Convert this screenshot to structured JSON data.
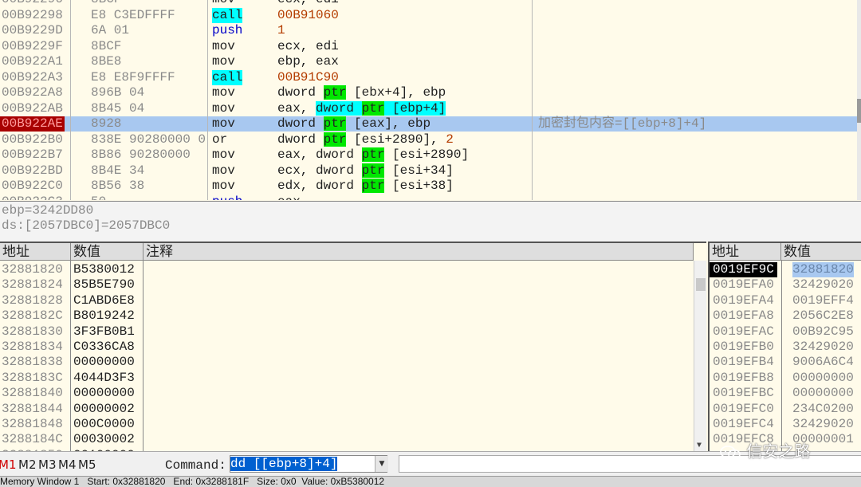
{
  "disasm": {
    "rows": [
      {
        "addr": "00B92296",
        "hex": "8BCF",
        "mn": "mov",
        "mn_style": "plain",
        "op": [
          {
            "t": "ecx, edi"
          }
        ],
        "partial": "top"
      },
      {
        "addr": "00B92298",
        "hex": "E8 C3EDFFFF",
        "mn": "call",
        "mn_style": "call",
        "op": [
          {
            "t": "00B91060",
            "s": "tgt"
          }
        ]
      },
      {
        "addr": "00B9229D",
        "hex": "6A 01",
        "mn": "push",
        "mn_style": "push",
        "op": [
          {
            "t": "1",
            "s": "num"
          }
        ]
      },
      {
        "addr": "00B9229F",
        "hex": "8BCF",
        "mn": "mov",
        "mn_style": "plain",
        "op": [
          {
            "t": "ecx, edi"
          }
        ]
      },
      {
        "addr": "00B922A1",
        "hex": "8BE8",
        "mn": "mov",
        "mn_style": "plain",
        "op": [
          {
            "t": "ebp, eax"
          }
        ]
      },
      {
        "addr": "00B922A3",
        "hex": "E8 E8F9FFFF",
        "mn": "call",
        "mn_style": "call",
        "op": [
          {
            "t": "00B91C90",
            "s": "tgt"
          }
        ]
      },
      {
        "addr": "00B922A8",
        "hex": "896B 04",
        "mn": "mov",
        "mn_style": "plain",
        "op": [
          {
            "t": "dword "
          },
          {
            "t": "ptr",
            "s": "ptr"
          },
          {
            "t": " [ebx+4], ebp"
          }
        ]
      },
      {
        "addr": "00B922AB",
        "hex": "8B45 04",
        "mn": "mov",
        "mn_style": "plain",
        "op": [
          {
            "t": "eax, "
          },
          {
            "t": "dword ",
            "s": "selbox"
          },
          {
            "t": "ptr",
            "s": "ptr"
          },
          {
            "t": " [ebp+4]",
            "s": "selbox"
          }
        ]
      },
      {
        "addr": "00B922AE",
        "hex": "8928",
        "mn": "mov",
        "mn_style": "plain",
        "op": [
          {
            "t": "dword "
          },
          {
            "t": "ptr",
            "s": "ptr"
          },
          {
            "t": " [eax], ebp"
          }
        ],
        "comment": "加密封包内容=[[ebp+8]+4]",
        "selected": true
      },
      {
        "addr": "00B922B0",
        "hex": "838E 90280000 0",
        "mn": "or",
        "mn_style": "plain",
        "op": [
          {
            "t": "dword "
          },
          {
            "t": "ptr",
            "s": "ptr"
          },
          {
            "t": " [esi+2890], "
          },
          {
            "t": "2",
            "s": "num"
          }
        ]
      },
      {
        "addr": "00B922B7",
        "hex": "8B86 90280000",
        "mn": "mov",
        "mn_style": "plain",
        "op": [
          {
            "t": "eax, dword "
          },
          {
            "t": "ptr",
            "s": "ptr"
          },
          {
            "t": " [esi+2890]"
          }
        ]
      },
      {
        "addr": "00B922BD",
        "hex": "8B4E 34",
        "mn": "mov",
        "mn_style": "plain",
        "op": [
          {
            "t": "ecx, dword "
          },
          {
            "t": "ptr",
            "s": "ptr"
          },
          {
            "t": " [esi+34]"
          }
        ]
      },
      {
        "addr": "00B922C0",
        "hex": "8B56 38",
        "mn": "mov",
        "mn_style": "plain",
        "op": [
          {
            "t": "edx, dword "
          },
          {
            "t": "ptr",
            "s": "ptr"
          },
          {
            "t": " [esi+38]"
          }
        ]
      },
      {
        "addr": "00B922C3",
        "hex": "50",
        "mn": "push",
        "mn_style": "push",
        "op": [
          {
            "t": "eax"
          }
        ],
        "partial": "bottom"
      }
    ]
  },
  "info": {
    "line1": "ebp=3242DD80",
    "line2": "ds:[2057DBC0]=2057DBC0"
  },
  "dump": {
    "headers": [
      "地址",
      "数值",
      "注释"
    ],
    "rows": [
      {
        "addr": "32881820",
        "val": "B5380012"
      },
      {
        "addr": "32881824",
        "val": "85B5E790"
      },
      {
        "addr": "32881828",
        "val": "C1ABD6E8"
      },
      {
        "addr": "3288182C",
        "val": "B8019242"
      },
      {
        "addr": "32881830",
        "val": "3F3FB0B1"
      },
      {
        "addr": "32881834",
        "val": "C0336CA8"
      },
      {
        "addr": "32881838",
        "val": "00000000"
      },
      {
        "addr": "3288183C",
        "val": "4044D3F3"
      },
      {
        "addr": "32881840",
        "val": "00000000"
      },
      {
        "addr": "32881844",
        "val": "00000002"
      },
      {
        "addr": "32881848",
        "val": "000C0000"
      },
      {
        "addr": "3288184C",
        "val": "00030002"
      },
      {
        "addr": "32881850",
        "val": "00100000"
      }
    ]
  },
  "stack": {
    "headers": [
      "地址",
      "数值"
    ],
    "rows": [
      {
        "addr": "0019EF9C",
        "val": "32881820",
        "selected": true
      },
      {
        "addr": "0019EFA0",
        "val": "32429020"
      },
      {
        "addr": "0019EFA4",
        "val": "0019EFF4"
      },
      {
        "addr": "0019EFA8",
        "val": "2056C2E8"
      },
      {
        "addr": "0019EFAC",
        "val": "00B92C95"
      },
      {
        "addr": "0019EFB0",
        "val": "32429020"
      },
      {
        "addr": "0019EFB4",
        "val": "9006A6C4"
      },
      {
        "addr": "0019EFB8",
        "val": "00000000"
      },
      {
        "addr": "0019EFBC",
        "val": "00000000"
      },
      {
        "addr": "0019EFC0",
        "val": "234C0200"
      },
      {
        "addr": "0019EFC4",
        "val": "32429020"
      },
      {
        "addr": "0019EFC8",
        "val": "00000001"
      }
    ]
  },
  "cmdbar": {
    "tabs": [
      "M1",
      "M2",
      "M3",
      "M4",
      "M5"
    ],
    "active_tab": "M1",
    "label": "Command:",
    "value": "dd [[ebp+8]+4]"
  },
  "status": {
    "text": "Memory Window 1   Start: 0x32881820   End: 0x3288181F   Size: 0x0  Value: 0xB5380012"
  },
  "watermark": {
    "text": "信安之路"
  },
  "colors": {
    "call_bg": "#00ffff",
    "ptr_bg": "#00e800",
    "selected_row": "#a8c8f0",
    "eip_marker": "#a80000",
    "panel_bg": "#fffbea"
  }
}
